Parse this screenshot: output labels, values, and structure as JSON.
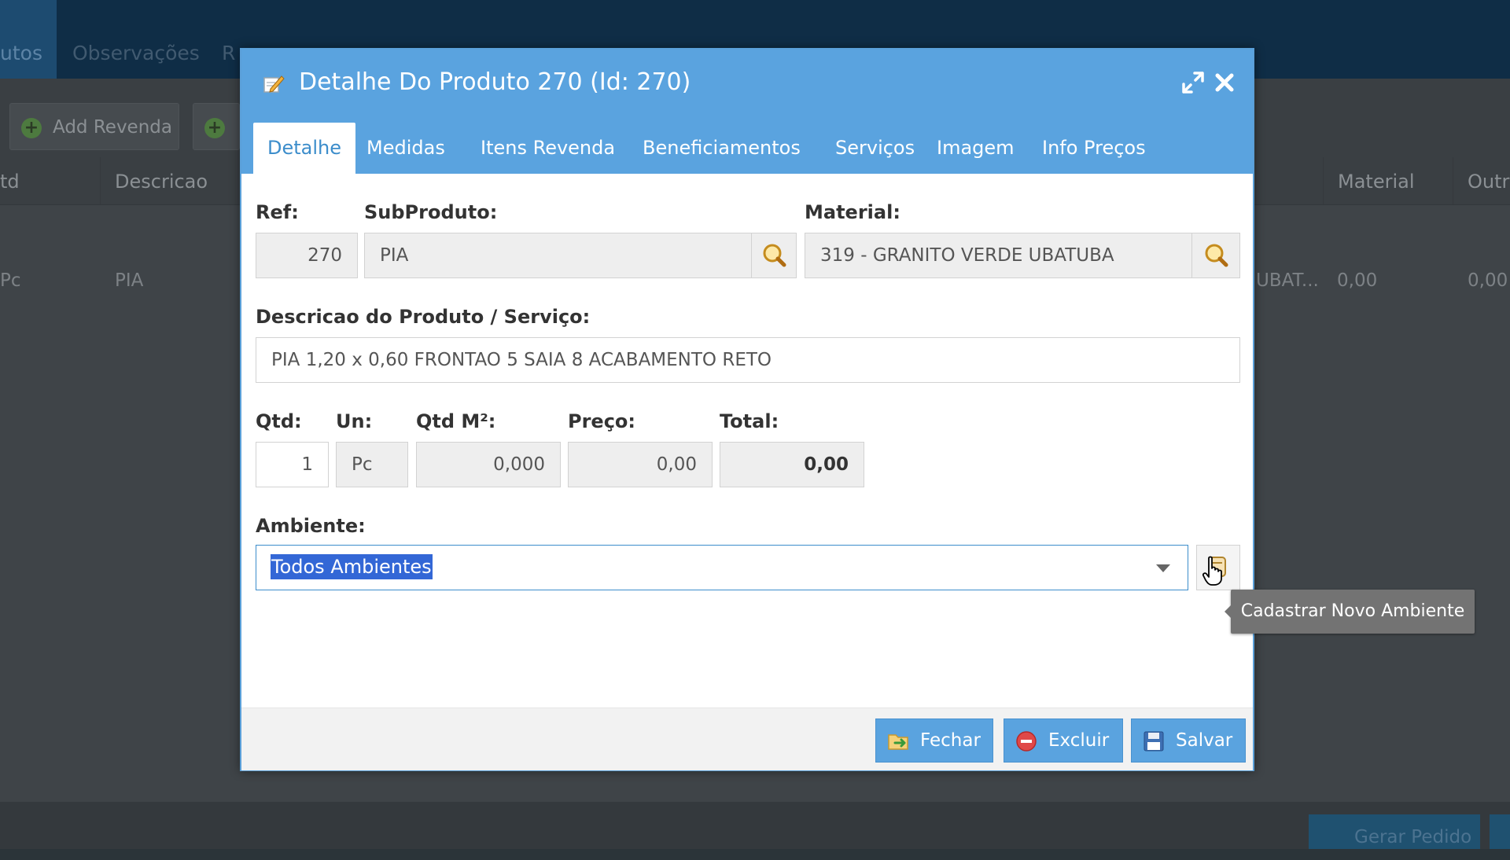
{
  "background": {
    "tabs": [
      "utos",
      "Observações",
      "R"
    ],
    "toolbar": {
      "add_revenda": "Add Revenda"
    },
    "table": {
      "columns": [
        "td",
        "Descricao",
        "Material",
        "Outr"
      ],
      "row": {
        "un": "Pc",
        "descricao": "PIA",
        "material_trunc": "UBAT...",
        "material_val": "0,00",
        "outr_val": "0,00"
      }
    },
    "gerar_pedido": "Gerar Pedido"
  },
  "modal": {
    "title": "Detalhe Do Produto 270 (Id: 270)",
    "tabs": [
      "Detalhe",
      "Medidas",
      "Itens Revenda",
      "Beneficiamentos",
      "Serviços",
      "Imagem",
      "Info Preços"
    ],
    "active_tab": "Detalhe",
    "form": {
      "ref_label": "Ref:",
      "ref_value": "270",
      "subproduto_label": "SubProduto:",
      "subproduto_value": "PIA",
      "material_label": "Material:",
      "material_value": "319 - GRANITO VERDE UBATUBA",
      "descricao_label": "Descricao do Produto / Serviço:",
      "descricao_value": "PIA 1,20 x 0,60 FRONTAO 5 SAIA 8 ACABAMENTO RETO",
      "qtd_label": "Qtd:",
      "qtd_value": "1",
      "un_label": "Un:",
      "un_value": "Pc",
      "qtdm2_label": "Qtd M²:",
      "qtdm2_value": "0,000",
      "preco_label": "Preço:",
      "preco_value": "0,00",
      "total_label": "Total:",
      "total_value": "0,00",
      "ambiente_label": "Ambiente:",
      "ambiente_value": "Todos Ambientes"
    },
    "buttons": {
      "fechar": "Fechar",
      "excluir": "Excluir",
      "salvar": "Salvar"
    },
    "tooltip": "Cadastrar Novo Ambiente"
  },
  "colors": {
    "header": "#5aa3df",
    "active_tab_text": "#3c8dcb",
    "selection": "#3367d6",
    "excluir_icon": "#e04848"
  }
}
